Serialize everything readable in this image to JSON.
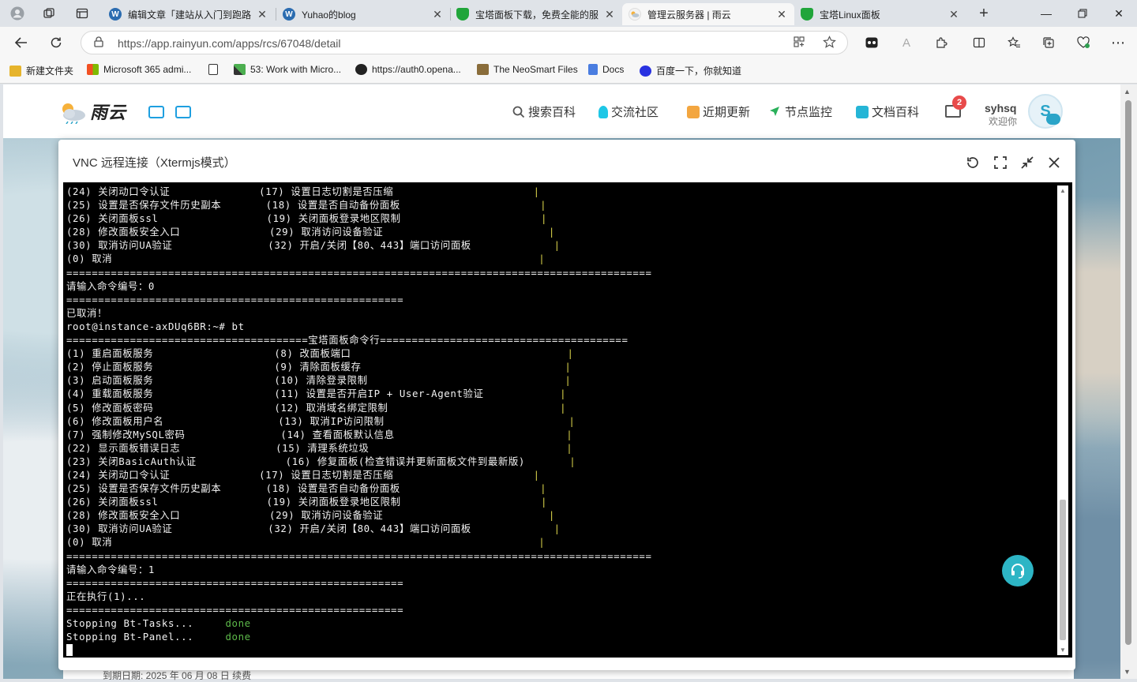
{
  "browser": {
    "tabs": [
      {
        "title": "编辑文章「建站从入门到跑路",
        "icon": "wordpress-icon",
        "active": false
      },
      {
        "title": "Yuhao的blog",
        "icon": "wordpress-icon",
        "active": false
      },
      {
        "title": "宝塔面板下载，免费全能的服",
        "icon": "bt-shield-icon",
        "active": false
      },
      {
        "title": "管理云服务器 | 雨云",
        "icon": "rainyun-icon",
        "active": true
      },
      {
        "title": "宝塔Linux面板",
        "icon": "bt-shield-icon",
        "active": false
      }
    ],
    "url": "https://app.rainyun.com/apps/rcs/67048/detail",
    "bookmarks": [
      {
        "label": "新建文件夹",
        "icon": "folder-icon"
      },
      {
        "label": "Microsoft 365 admi...",
        "icon": "microsoft-icon"
      },
      {
        "label": "",
        "icon": "page-icon"
      },
      {
        "label": "53: Work with Micro...",
        "icon": "chart-icon"
      },
      {
        "label": "https://auth0.opena...",
        "icon": "openai-icon"
      },
      {
        "label": "The NeoSmart Files",
        "icon": "neosmart-icon"
      },
      {
        "label": "Docs",
        "icon": "docs-icon"
      },
      {
        "label": "百度一下，你就知道",
        "icon": "baidu-icon"
      }
    ]
  },
  "site": {
    "logo_text": "雨云",
    "nav": [
      {
        "label": "搜索百科",
        "icon": "search-icon"
      },
      {
        "label": "交流社区",
        "icon": "community-icon"
      },
      {
        "label": "近期更新",
        "icon": "updates-icon"
      },
      {
        "label": "节点监控",
        "icon": "monitor-icon"
      },
      {
        "label": "文档百科",
        "icon": "docs-book-icon"
      }
    ],
    "mail_badge": "2",
    "user_name": "syhsq",
    "user_greeting": "欢迎你",
    "avatar_letter": "S",
    "below_text": "到期日期: 2025 年 06 月 08 日 续费"
  },
  "modal": {
    "title": "VNC 远程连接（Xtermjs模式）"
  },
  "terminal": {
    "lines": [
      [
        {
          "t": "(24) 关闭动口令认证              (17) 设置日志切割是否压缩                      "
        },
        {
          "t": "|",
          "c": "y"
        }
      ],
      [
        {
          "t": "(25) 设置是否保存文件历史副本       (18) 设置是否自动备份面板                      "
        },
        {
          "t": "|",
          "c": "y"
        }
      ],
      [
        {
          "t": "(26) 关闭面板ssl                 (19) 关闭面板登录地区限制                      "
        },
        {
          "t": "|",
          "c": "y"
        }
      ],
      [
        {
          "t": "(28) 修改面板安全入口              (29) 取消访问设备验证                          "
        },
        {
          "t": "|",
          "c": "y"
        }
      ],
      [
        {
          "t": "(30) 取消访问UA验证               (32) 开启/关闭【80、443】端口访问面板             "
        },
        {
          "t": "|",
          "c": "y"
        }
      ],
      [
        {
          "t": "(0) 取消                                                                   "
        },
        {
          "t": "|",
          "c": "y"
        }
      ],
      [
        {
          "t": "============================================================================================"
        }
      ],
      [
        {
          "t": "请输入命令编号：0"
        }
      ],
      [
        {
          "t": "====================================================="
        }
      ],
      [
        {
          "t": "已取消！"
        }
      ],
      [
        {
          "t": "root@instance-axDUq6BR:~# bt"
        }
      ],
      [
        {
          "t": "======================================宝塔面板命令行======================================="
        }
      ],
      [
        {
          "t": "(1) 重启面板服务                   (8) 改面板端口                                  "
        },
        {
          "t": "|",
          "c": "y"
        }
      ],
      [
        {
          "t": "(2) 停止面板服务                   (9) 清除面板缓存                                "
        },
        {
          "t": "|",
          "c": "y"
        }
      ],
      [
        {
          "t": "(3) 启动面板服务                   (10) 清除登录限制                               "
        },
        {
          "t": "|",
          "c": "y"
        }
      ],
      [
        {
          "t": "(4) 重载面板服务                   (11) 设置是否开启IP + User-Agent验证            "
        },
        {
          "t": "|",
          "c": "y"
        }
      ],
      [
        {
          "t": "(5) 修改面板密码                   (12) 取消域名绑定限制                           "
        },
        {
          "t": "|",
          "c": "y"
        }
      ],
      [
        {
          "t": "(6) 修改面板用户名                  (13) 取消IP访问限制                             "
        },
        {
          "t": "|",
          "c": "y"
        }
      ],
      [
        {
          "t": "(7) 强制修改MySQL密码               (14) 查看面板默认信息                           "
        },
        {
          "t": "|",
          "c": "y"
        }
      ],
      [
        {
          "t": "(22) 显示面板错误日志               (15) 清理系统垃圾                               "
        },
        {
          "t": "|",
          "c": "y"
        }
      ],
      [
        {
          "t": "(23) 关闭BasicAuth认证              (16) 修复面板(检查错误并更新面板文件到最新版)       "
        },
        {
          "t": "|",
          "c": "y"
        }
      ],
      [
        {
          "t": "(24) 关闭动口令认证              (17) 设置日志切割是否压缩                      "
        },
        {
          "t": "|",
          "c": "y"
        }
      ],
      [
        {
          "t": "(25) 设置是否保存文件历史副本       (18) 设置是否自动备份面板                      "
        },
        {
          "t": "|",
          "c": "y"
        }
      ],
      [
        {
          "t": "(26) 关闭面板ssl                 (19) 关闭面板登录地区限制                      "
        },
        {
          "t": "|",
          "c": "y"
        }
      ],
      [
        {
          "t": "(28) 修改面板安全入口              (29) 取消访问设备验证                          "
        },
        {
          "t": "|",
          "c": "y"
        }
      ],
      [
        {
          "t": "(30) 取消访问UA验证               (32) 开启/关闭【80、443】端口访问面板             "
        },
        {
          "t": "|",
          "c": "y"
        }
      ],
      [
        {
          "t": "(0) 取消                                                                   "
        },
        {
          "t": "|",
          "c": "y"
        }
      ],
      [
        {
          "t": "============================================================================================"
        }
      ],
      [
        {
          "t": "请输入命令编号：1"
        }
      ],
      [
        {
          "t": "====================================================="
        }
      ],
      [
        {
          "t": "正在执行(1)..."
        }
      ],
      [
        {
          "t": "====================================================="
        }
      ],
      [
        {
          "t": "Stopping Bt-Tasks...     "
        },
        {
          "t": "done",
          "c": "g"
        }
      ],
      [
        {
          "t": "Stopping Bt-Panel...     "
        },
        {
          "t": "done",
          "c": "g"
        }
      ]
    ]
  }
}
